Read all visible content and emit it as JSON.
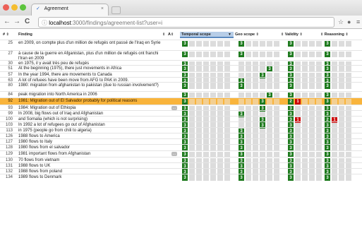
{
  "browser": {
    "tab_title": "Agreement",
    "tab_close": "×",
    "url_host": "localhost",
    "url_rest": ":3000/findings/agreement-list?user=i",
    "back": "←",
    "forward": "→",
    "reload": "C"
  },
  "table": {
    "headers": {
      "id": "#",
      "finding": "Finding",
      "az": "A",
      "temporal": "Temporal scope",
      "geo": "Geo scope",
      "validity": "Validity",
      "reasoning": "Reasoning"
    },
    "rows": [
      {
        "id": "25",
        "finding": "en 2009, on compte plus d'un million de refugés ont passé de l'Iraq en Syrie",
        "temporal": "3",
        "geo": "3",
        "validity": "3",
        "reasoning": "3"
      },
      {
        "id": "27",
        "finding": "à cause de la guerre en Afganistan, plus d'un million de refugés ont franchi l'Iran en 2009",
        "temporal": "3",
        "geo": "3",
        "validity": "3",
        "reasoning": "3"
      },
      {
        "id": "30",
        "finding": "en 1975, il y avait très peu de refugés",
        "temporal": "3",
        "geo": "",
        "validity": "3",
        "reasoning": "3"
      },
      {
        "id": "51",
        "finding": "At the beginning (1975), there just movements in Africa",
        "temporal": "3",
        "geo": "3",
        "validity": "3",
        "reasoning": "3"
      },
      {
        "id": "57",
        "finding": "In the year 1994, there are movements to Canada",
        "temporal": "3",
        "geo": "3",
        "validity": "3",
        "reasoning": "3"
      },
      {
        "id": "63",
        "finding": "A lot of refuees have been move from AFG to PAK in 2009.",
        "temporal": "3",
        "geo": "3",
        "validity": "3",
        "reasoning": "3"
      },
      {
        "id": "80",
        "finding": "1980: migration from afghanistan to pakistan (due to russian involvement?)",
        "temporal": "3",
        "geo": "3",
        "validity": "3",
        "reasoning": "3"
      },
      {
        "id": "84",
        "finding": "peak migration into North America in 2006",
        "temporal": "3",
        "geo": "3",
        "validity": "3",
        "reasoning": "3"
      },
      {
        "id": "92",
        "finding": "1981: Migration out of El Salvador probably for political reasons",
        "temporal": "3",
        "geo": "3",
        "validity": "2",
        "validity_flag": "1",
        "reasoning": "3"
      },
      {
        "id": "93",
        "finding": "1984: Migration out of Ethiopia",
        "temporal": "3",
        "geo": "3",
        "validity": "3",
        "reasoning": "3",
        "comment": "..."
      },
      {
        "id": "99",
        "finding": "In 2008, big flows out of Iraq and Afghanistan",
        "temporal": "3",
        "geo": "3",
        "validity": "3",
        "reasoning": "3"
      },
      {
        "id": "100",
        "finding": "and Somalia (which is not surprising)",
        "temporal": "3",
        "geo": "3",
        "validity": "3",
        "validity_flag": "1",
        "reasoning": "2",
        "reasoning_flag": "1"
      },
      {
        "id": "103",
        "finding": "In 1992 a lot of refugees go out of Afghanistan",
        "temporal": "3",
        "geo": "3",
        "validity": "3",
        "reasoning": "3"
      },
      {
        "id": "113",
        "finding": "in 1975 (people go from chili to algeria)",
        "temporal": "3",
        "geo": "3",
        "validity": "3",
        "reasoning": "3"
      },
      {
        "id": "126",
        "finding": "1988 flows to America",
        "temporal": "3",
        "geo": "3",
        "validity": "3",
        "reasoning": "3"
      },
      {
        "id": "127",
        "finding": "1980 flows to Italy",
        "temporal": "3",
        "geo": "3",
        "validity": "3",
        "reasoning": "3"
      },
      {
        "id": "128",
        "finding": "1980 flows from el salvador",
        "temporal": "3",
        "geo": "3",
        "validity": "3",
        "reasoning": "3"
      },
      {
        "id": "129",
        "finding": "1981 important flows from Afghanistan",
        "temporal": "3",
        "geo": "3",
        "validity": "3",
        "reasoning": "3",
        "comment": "..."
      },
      {
        "id": "130",
        "finding": "70 flows from vietnam",
        "temporal": "3",
        "geo": "3",
        "validity": "3",
        "reasoning": "3"
      },
      {
        "id": "131",
        "finding": "1988 flows to UK",
        "temporal": "3",
        "geo": "3",
        "validity": "3",
        "reasoning": "3"
      },
      {
        "id": "132",
        "finding": "1988 flows from poland",
        "temporal": "3",
        "geo": "3",
        "validity": "3",
        "reasoning": "3"
      },
      {
        "id": "134",
        "finding": "1989 flows to Denmark",
        "temporal": "3",
        "geo": "3",
        "validity": "3",
        "reasoning": "3"
      }
    ]
  },
  "colors": {
    "green": "#1e7a1e",
    "highlight": "#f9b43c",
    "red": "#cc0000"
  }
}
